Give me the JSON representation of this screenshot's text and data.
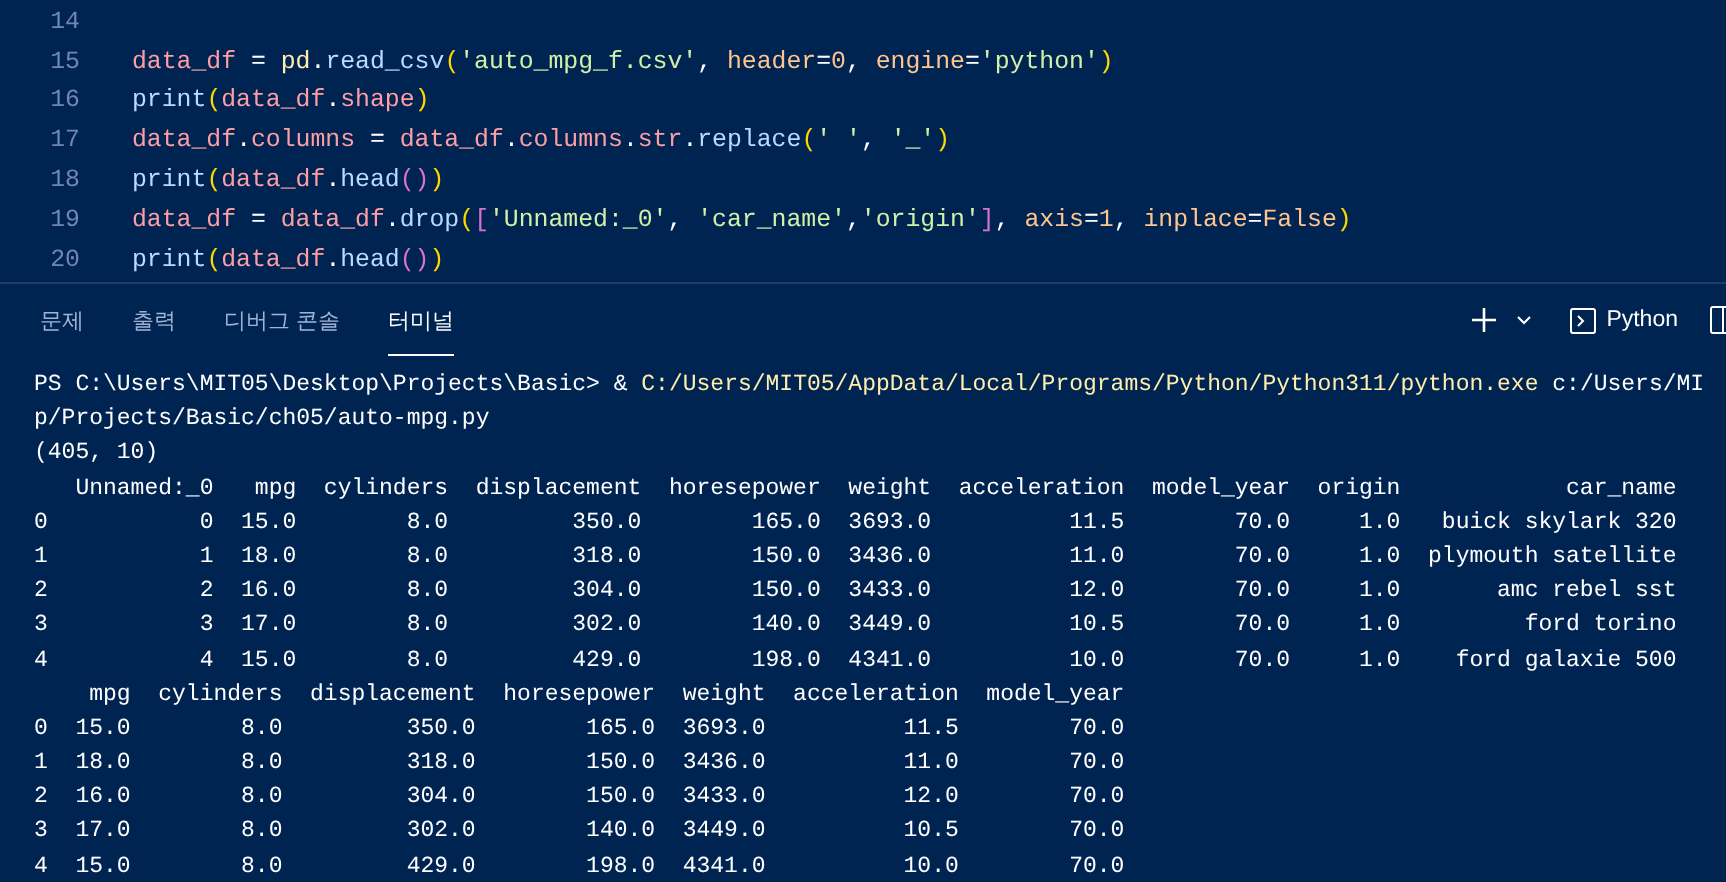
{
  "editor": {
    "lines": [
      {
        "number": "14"
      },
      {
        "number": "15",
        "tokens": [
          {
            "text": "data_df",
            "kind": "var"
          },
          {
            "text": " = ",
            "kind": "plain"
          },
          {
            "text": "pd",
            "kind": "mod"
          },
          {
            "text": ".",
            "kind": "plain"
          },
          {
            "text": "read_csv",
            "kind": "fn"
          },
          {
            "text": "(",
            "kind": "b1"
          },
          {
            "text": "'auto_mpg_f.csv'",
            "kind": "str"
          },
          {
            "text": ", ",
            "kind": "plain"
          },
          {
            "text": "header",
            "kind": "param"
          },
          {
            "text": "=",
            "kind": "plain"
          },
          {
            "text": "0",
            "kind": "num"
          },
          {
            "text": ", ",
            "kind": "plain"
          },
          {
            "text": "engine",
            "kind": "param"
          },
          {
            "text": "=",
            "kind": "plain"
          },
          {
            "text": "'python'",
            "kind": "str"
          },
          {
            "text": ")",
            "kind": "b1"
          }
        ]
      },
      {
        "number": "16",
        "tokens": [
          {
            "text": "print",
            "kind": "fn"
          },
          {
            "text": "(",
            "kind": "b1"
          },
          {
            "text": "data_df",
            "kind": "var"
          },
          {
            "text": ".",
            "kind": "plain"
          },
          {
            "text": "shape",
            "kind": "var"
          },
          {
            "text": ")",
            "kind": "b1"
          }
        ]
      },
      {
        "number": "17",
        "tokens": [
          {
            "text": "data_df",
            "kind": "var"
          },
          {
            "text": ".",
            "kind": "plain"
          },
          {
            "text": "columns",
            "kind": "var"
          },
          {
            "text": " = ",
            "kind": "plain"
          },
          {
            "text": "data_df",
            "kind": "var"
          },
          {
            "text": ".",
            "kind": "plain"
          },
          {
            "text": "columns",
            "kind": "var"
          },
          {
            "text": ".",
            "kind": "plain"
          },
          {
            "text": "str",
            "kind": "var"
          },
          {
            "text": ".",
            "kind": "plain"
          },
          {
            "text": "replace",
            "kind": "fn"
          },
          {
            "text": "(",
            "kind": "b1"
          },
          {
            "text": "' '",
            "kind": "str"
          },
          {
            "text": ", ",
            "kind": "plain"
          },
          {
            "text": "'_'",
            "kind": "str"
          },
          {
            "text": ")",
            "kind": "b1"
          }
        ]
      },
      {
        "number": "18",
        "tokens": [
          {
            "text": "print",
            "kind": "fn"
          },
          {
            "text": "(",
            "kind": "b1"
          },
          {
            "text": "data_df",
            "kind": "var"
          },
          {
            "text": ".",
            "kind": "plain"
          },
          {
            "text": "head",
            "kind": "fn"
          },
          {
            "text": "()",
            "kind": "b2"
          },
          {
            "text": ")",
            "kind": "b1"
          }
        ]
      },
      {
        "number": "19",
        "tokens": [
          {
            "text": "data_df",
            "kind": "var"
          },
          {
            "text": " = ",
            "kind": "plain"
          },
          {
            "text": "data_df",
            "kind": "var"
          },
          {
            "text": ".",
            "kind": "plain"
          },
          {
            "text": "drop",
            "kind": "fn"
          },
          {
            "text": "(",
            "kind": "b1"
          },
          {
            "text": "[",
            "kind": "b2"
          },
          {
            "text": "'Unnamed:_0'",
            "kind": "str"
          },
          {
            "text": ", ",
            "kind": "plain"
          },
          {
            "text": "'car_name'",
            "kind": "str"
          },
          {
            "text": ",",
            "kind": "plain"
          },
          {
            "text": "'origin'",
            "kind": "str"
          },
          {
            "text": "]",
            "kind": "b2"
          },
          {
            "text": ", ",
            "kind": "plain"
          },
          {
            "text": "axis",
            "kind": "param"
          },
          {
            "text": "=",
            "kind": "plain"
          },
          {
            "text": "1",
            "kind": "num"
          },
          {
            "text": ", ",
            "kind": "plain"
          },
          {
            "text": "inplace",
            "kind": "param"
          },
          {
            "text": "=",
            "kind": "plain"
          },
          {
            "text": "False",
            "kind": "num"
          },
          {
            "text": ")",
            "kind": "b1"
          }
        ]
      },
      {
        "number": "20",
        "tokens": [
          {
            "text": "print",
            "kind": "fn"
          },
          {
            "text": "(",
            "kind": "b1"
          },
          {
            "text": "data_df",
            "kind": "var"
          },
          {
            "text": ".",
            "kind": "plain"
          },
          {
            "text": "head",
            "kind": "fn"
          },
          {
            "text": "()",
            "kind": "b2"
          },
          {
            "text": ")",
            "kind": "b1"
          }
        ]
      }
    ]
  },
  "panel": {
    "tabs": [
      {
        "label": "문제",
        "selected": false
      },
      {
        "label": "출력",
        "selected": false
      },
      {
        "label": "디버그 콘솔",
        "selected": false
      },
      {
        "label": "터미널",
        "selected": true
      }
    ],
    "terminal_name": "Python"
  },
  "terminal": {
    "prompt": "PS C:\\Users\\MIT05\\Desktop\\Projects\\Basic> & ",
    "command": "C:/Users/MIT05/AppData/Local/Programs/Python/Python311/python.exe",
    "args": " c:/Users/MI",
    "output": [
      "p/Projects/Basic/ch05/auto-mpg.py",
      "(405, 10)",
      "   Unnamed:_0   mpg  cylinders  displacement  horesepower  weight  acceleration  model_year  origin            car_name",
      "0           0  15.0        8.0         350.0        165.0  3693.0          11.5        70.0     1.0   buick skylark 320",
      "1           1  18.0        8.0         318.0        150.0  3436.0          11.0        70.0     1.0  plymouth satellite",
      "2           2  16.0        8.0         304.0        150.0  3433.0          12.0        70.0     1.0       amc rebel sst",
      "3           3  17.0        8.0         302.0        140.0  3449.0          10.5        70.0     1.0         ford torino",
      "4           4  15.0        8.0         429.0        198.0  4341.0          10.0        70.0     1.0    ford galaxie 500",
      "    mpg  cylinders  displacement  horesepower  weight  acceleration  model_year",
      "0  15.0        8.0         350.0        165.0  3693.0          11.5        70.0",
      "1  18.0        8.0         318.0        150.0  3436.0          11.0        70.0",
      "2  16.0        8.0         304.0        150.0  3433.0          12.0        70.0",
      "3  17.0        8.0         302.0        140.0  3449.0          10.5        70.0",
      "4  15.0        8.0         429.0        198.0  4341.0          10.0        70.0"
    ]
  }
}
